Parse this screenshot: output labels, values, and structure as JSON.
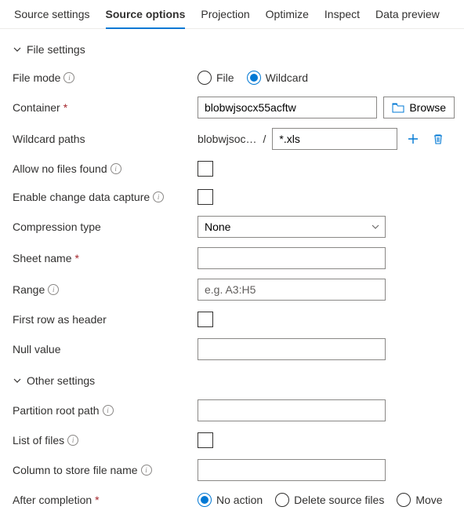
{
  "tabs": {
    "items": [
      "Source settings",
      "Source options",
      "Projection",
      "Optimize",
      "Inspect",
      "Data preview"
    ],
    "activeIndex": 1
  },
  "sections": {
    "file": "File settings",
    "other": "Other settings"
  },
  "labels": {
    "fileMode": "File mode",
    "container": "Container",
    "wildcardPaths": "Wildcard paths",
    "allowNoFiles": "Allow no files found",
    "enableCdc": "Enable change data capture",
    "compressionType": "Compression type",
    "sheetName": "Sheet name",
    "range": "Range",
    "firstRowHeader": "First row as header",
    "nullValue": "Null value",
    "partitionRoot": "Partition root path",
    "listOfFiles": "List of files",
    "columnStore": "Column to store file name",
    "afterCompletion": "After completion",
    "browse": "Browse"
  },
  "fileMode": {
    "options": {
      "file": "File",
      "wildcard": "Wildcard"
    },
    "selected": "wildcard"
  },
  "container": {
    "value": "blobwjsocx55acftw"
  },
  "wildcard": {
    "prefix": "blobwjsoc…",
    "value": "*.xls"
  },
  "allowNoFiles": {
    "checked": false
  },
  "enableCdc": {
    "checked": false
  },
  "compression": {
    "value": "None"
  },
  "sheetName": {
    "value": ""
  },
  "range": {
    "value": "",
    "placeholder": "e.g. A3:H5"
  },
  "firstRowHeader": {
    "checked": false
  },
  "nullValue": {
    "value": ""
  },
  "partitionRoot": {
    "value": ""
  },
  "listOfFiles": {
    "checked": false
  },
  "columnStore": {
    "value": ""
  },
  "afterCompletion": {
    "options": {
      "noAction": "No action",
      "delete": "Delete source files",
      "move": "Move"
    },
    "selected": "noAction"
  }
}
